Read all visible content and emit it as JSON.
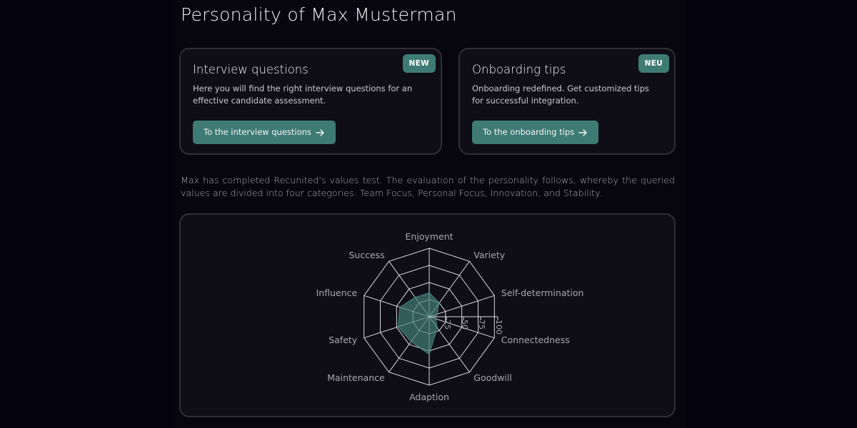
{
  "page": {
    "title": "Personality of Max Musterman"
  },
  "cards": [
    {
      "badge": "NEW",
      "title": "Interview questions",
      "description": "Here you will find the right interview questions for an effective candidate assessment.",
      "button_label": "To the interview questions",
      "button_icon": "arrow-right-icon"
    },
    {
      "badge": "NEU",
      "title": "Onboarding tips",
      "description": "Onboarding redefined. Get customized tips for successful integration.",
      "button_label": "To the onboarding tips",
      "button_icon": "arrow-right-icon"
    }
  ],
  "intro": "Max has completed Recunited's values test. The evaluation of the personality follows, whereby the queried values are divided into four categories: Team Focus, Personal Focus, Innovation, and Stability.",
  "colors": {
    "accent": "#3f7b75",
    "background": "#04030d",
    "card_background": "#0f0e16",
    "card_border": "#2f2f35",
    "chart_fill": "#3a6b66",
    "chart_grid": "#d8d8dc"
  },
  "chart_data": {
    "type": "radar",
    "categories": [
      "Enjoyment",
      "Variety",
      "Self-determination",
      "Connectedness",
      "Goodwill",
      "Adaption",
      "Maintenance",
      "Safety",
      "Influence",
      "Success"
    ],
    "values": [
      35,
      25,
      12,
      10,
      20,
      55,
      45,
      48,
      45,
      35
    ],
    "ticks": [
      "25",
      "50",
      "75",
      "100"
    ],
    "range": [
      0,
      100
    ]
  }
}
